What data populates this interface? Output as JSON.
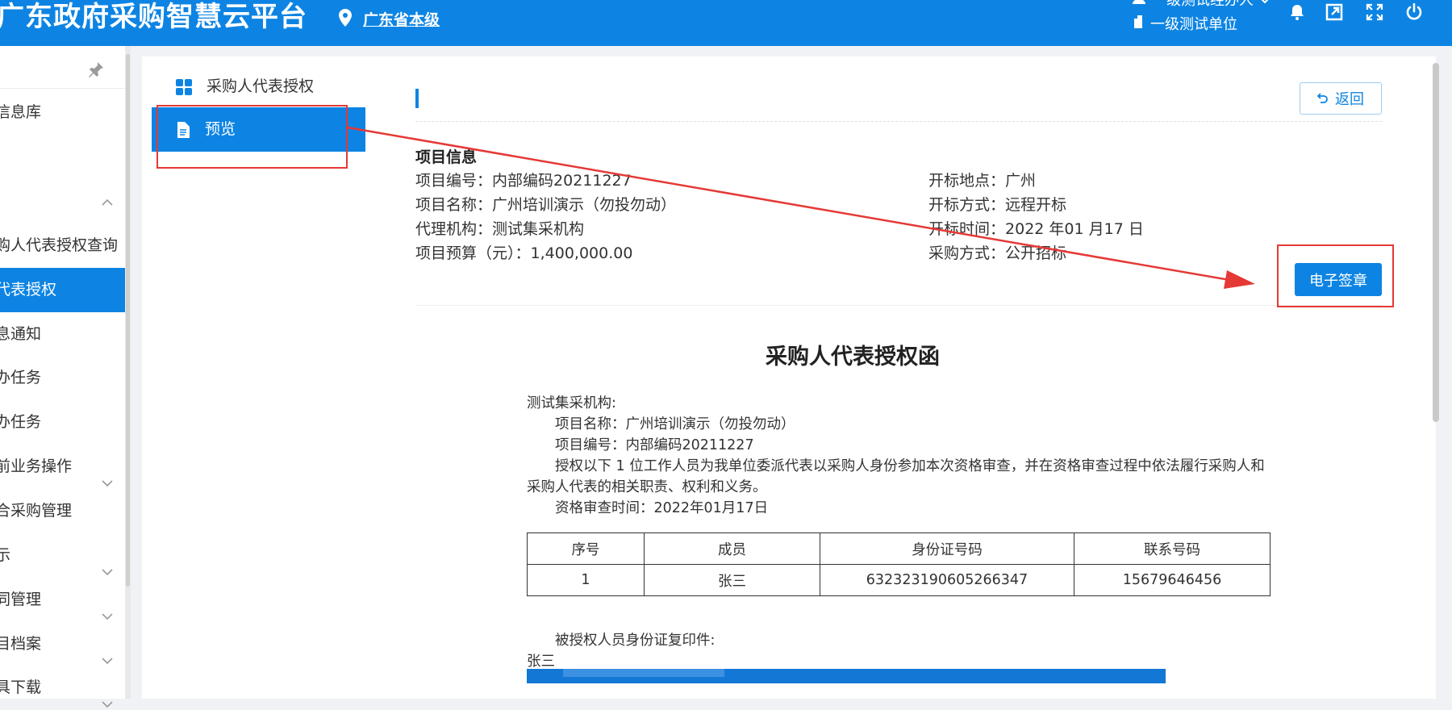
{
  "header": {
    "brand": "广东政府采购智慧云平台",
    "region": "广东省本级",
    "user_name": "一级测试经办人",
    "org_name": "一级测试单位",
    "bg_color": "#0d84e3"
  },
  "sidebar": {
    "items": [
      {
        "label": "信息库",
        "active": false
      },
      {
        "label": "购人代表授权查询",
        "active": false
      },
      {
        "label": "代表授权",
        "active": true
      },
      {
        "label": "息通知",
        "active": false
      },
      {
        "label": "办任务",
        "active": false
      },
      {
        "label": "办任务",
        "active": false
      },
      {
        "label": "前业务操作",
        "active": false
      },
      {
        "label": "合采购管理",
        "active": false
      },
      {
        "label": "示",
        "active": false
      },
      {
        "label": "同管理",
        "active": false
      },
      {
        "label": "目档案",
        "active": false
      },
      {
        "label": "具下载",
        "active": false
      }
    ]
  },
  "subnav": {
    "items": [
      {
        "label": "采购人代表授权",
        "icon": "grid-icon"
      },
      {
        "label": "预览",
        "icon": "document-icon"
      }
    ]
  },
  "toolbar": {
    "back_label": "返回",
    "sign_label": "电子签章"
  },
  "project": {
    "section_title": "项目信息",
    "left": [
      {
        "label": "项目编号：",
        "value": "内部编码20211227"
      },
      {
        "label": "项目名称：",
        "value": "广州培训演示（勿投勿动）"
      },
      {
        "label": "代理机构：",
        "value": "测试集采机构"
      },
      {
        "label": "项目预算（元）：",
        "value": "1,400,000.00"
      }
    ],
    "right": [
      {
        "label": "开标地点：",
        "value": "广州"
      },
      {
        "label": "开标方式：",
        "value": "远程开标"
      },
      {
        "label": "开标时间：",
        "value": "2022 年01 月17 日"
      },
      {
        "label": "采购方式：",
        "value": "公开招标"
      }
    ]
  },
  "letter": {
    "title": "采购人代表授权函",
    "addressee": "测试集采机构:",
    "project_name_line": "项目名称：广州培训演示（勿投勿动）",
    "project_no_line": "项目编号：内部编码20211227",
    "body_line1": "授权以下 1 位工作人员为我单位委派代表以采购人身份参加本次资格审查，并在资格审查过程中依法履行采购人和",
    "body_line2": "采购人代表的相关职责、权利和义务。",
    "review_time": "资格审查时间：2022年01月17日",
    "table": {
      "headers": [
        "序号",
        "成员",
        "身份证号码",
        "联系号码"
      ],
      "rows": [
        [
          "1",
          "张三",
          "632323190605266347",
          "15679646456"
        ]
      ]
    },
    "id_copy_label": "被授权人员身份证复印件:",
    "person": "张三"
  },
  "colors": {
    "accent": "#0d84e3",
    "annotation": "#e53935"
  }
}
